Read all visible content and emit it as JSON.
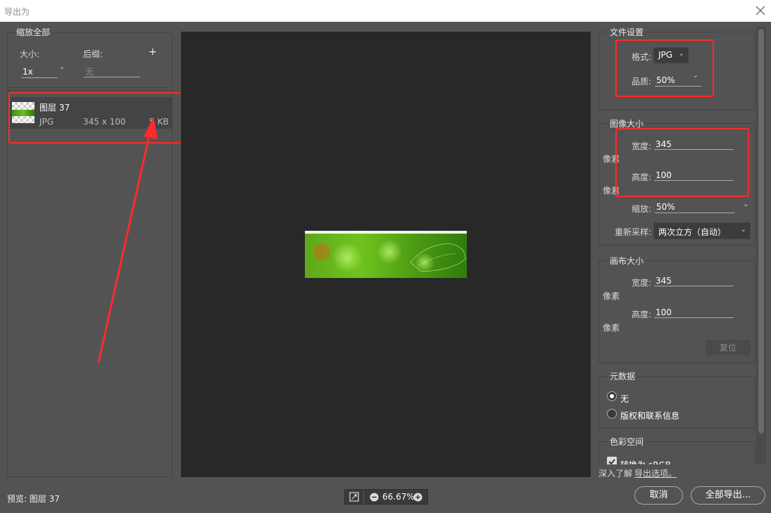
{
  "window": {
    "title": "导出为"
  },
  "left_panel": {
    "group_title": "缩放全部",
    "size_label": "大小:",
    "suffix_label": "后缀:",
    "add_symbol": "+",
    "scale_value": "1x",
    "suffix_placeholder": "无",
    "layer": {
      "name": "图层 37",
      "format": "JPG",
      "dimensions": "345 x 100",
      "filesize": "5 KB"
    }
  },
  "file_settings": {
    "title": "文件设置",
    "format_label": "格式:",
    "format_value": "JPG",
    "quality_label": "品质:",
    "quality_value": "50%"
  },
  "image_size": {
    "title": "图像大小",
    "width_label": "宽度:",
    "width_value": "345",
    "height_label": "高度:",
    "height_value": "100",
    "unit1": "像素",
    "unit2": "像素",
    "scale_label": "缩放:",
    "scale_value": "50%",
    "resample_label": "重新采样:",
    "resample_value": "两次立方（自动）"
  },
  "canvas_size": {
    "title": "画布大小",
    "width_label": "宽度:",
    "width_value": "345",
    "height_label": "高度:",
    "height_value": "100",
    "unit1": "像素",
    "unit2": "像素",
    "reset_label": "复位"
  },
  "metadata": {
    "title": "元数据",
    "option_none": "无",
    "option_copyright": "版权和联系信息",
    "selected": "无"
  },
  "color_space": {
    "title": "色彩空间",
    "convert_label": "转换为 sRGB",
    "checked": true
  },
  "learn_more": {
    "prefix": "深入了解",
    "link": "导出选项。"
  },
  "footer": {
    "preview_label": "预览: 图层 37",
    "zoom_value": "66.67%",
    "cancel_label": "取消",
    "export_all_label": "全部导出..."
  },
  "colors": {
    "annotation_red": "#ff2a2a",
    "preview_bg": "#282828",
    "panel_bg": "#535353"
  }
}
